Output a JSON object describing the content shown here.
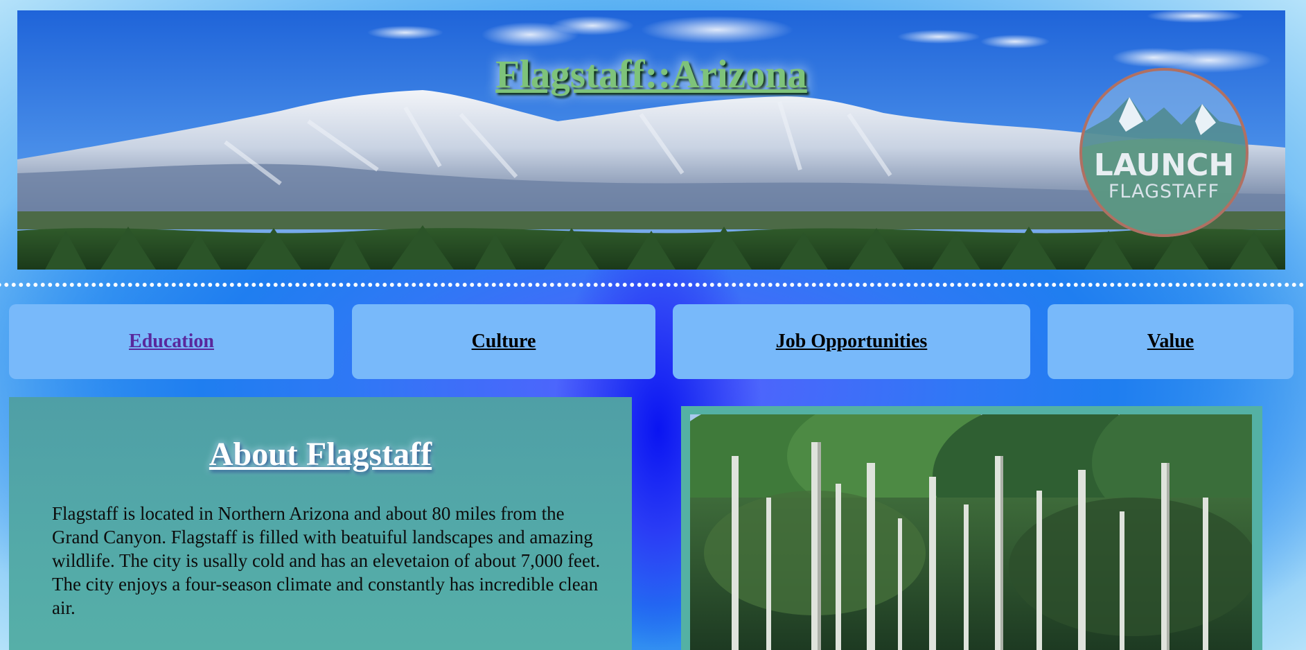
{
  "header": {
    "site_title": "Flagstaff::Arizona",
    "logo_text_main": "LAUNCH",
    "logo_text_sub": "FLAGSTAFF"
  },
  "nav": {
    "items": [
      {
        "label": "Education"
      },
      {
        "label": "Culture"
      },
      {
        "label": "Job Opportunities"
      },
      {
        "label": "Value"
      }
    ]
  },
  "about": {
    "title": "About Flagstaff",
    "body": "Flagstaff is located in Northern Arizona and about 80 miles from the Grand Canyon. Flagstaff is filled with beatuiful landscapes and amazing wildlife. The city is usally cold and has an elevetaion of about 7,000 feet. The city enjoys a four-season climate and constantly has incredible clean air."
  },
  "colors": {
    "nav_bg": "#78b9fa",
    "about_bg": "#53a9a8",
    "title_green": "#7ec37a",
    "visited_link": "#59289c"
  }
}
